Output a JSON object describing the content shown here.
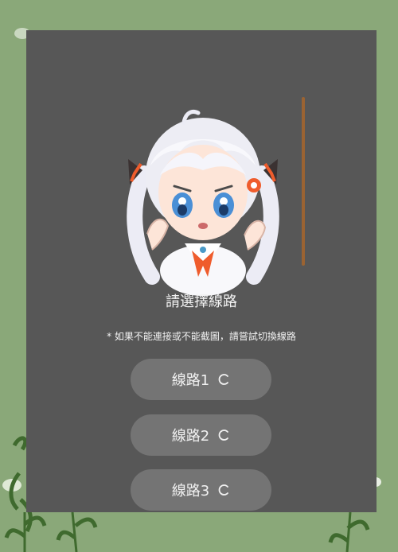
{
  "modal": {
    "title": "請選擇線路",
    "note": "* 如果不能連接或不能截圖，請嘗試切換線路"
  },
  "routes": [
    {
      "label": "線路1",
      "icon": "reload-icon"
    },
    {
      "label": "線路2",
      "icon": "reload-icon"
    },
    {
      "label": "線路3",
      "icon": "reload-icon"
    }
  ],
  "colors": {
    "background": "#8aa879",
    "modal": "#575757",
    "button": "#747474",
    "accent": "#9b6332"
  }
}
